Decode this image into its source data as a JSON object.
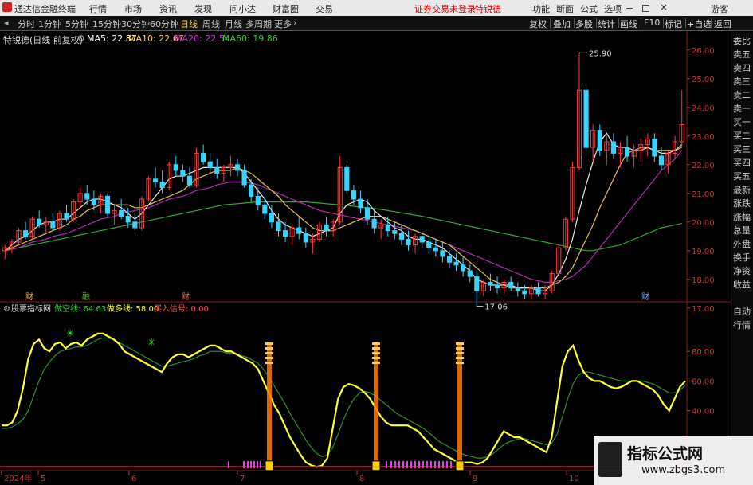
{
  "titlebar": {
    "app_name": "通达信金融终端",
    "menus": [
      "行情",
      "市场",
      "资讯",
      "发现",
      "问小达",
      "财富圈",
      "交易"
    ],
    "login_status": "证券交易未登录",
    "stock_name": "特锐德",
    "right_menus": [
      "功能",
      "断面",
      "公式",
      "选项"
    ],
    "user": "游客"
  },
  "toolbar": {
    "periods": [
      "分时",
      "1分钟",
      "5分钟",
      "15分钟",
      "30分钟",
      "60分钟",
      "日线",
      "周线",
      "月线",
      "多周期",
      "更多"
    ],
    "active_period": "日线",
    "right_buttons": [
      "复权",
      "叠加",
      "多股",
      "统计",
      "画线",
      "F10",
      "标记",
      "+自选",
      "返回"
    ]
  },
  "ma_line": {
    "title": "特锐德(日线 前复权)",
    "ma5": "MA5: 22.87",
    "ma10": "MA10: 22.67",
    "ma20": "MA20: 22.54",
    "ma60": "MA60: 19.86",
    "colors": {
      "ma5": "#ffffff",
      "ma10": "#ffd24d",
      "ma20": "#cc33cc",
      "ma60": "#33cc33"
    }
  },
  "indicator_line": {
    "title": "股票指标网",
    "line1": "做空线: 64.63",
    "line2": "做多线: 58.00",
    "line3": "买入信号: 0.00"
  },
  "right_sidebar": {
    "labels": [
      "委比",
      "卖五",
      "卖四",
      "卖三",
      "卖二",
      "卖一",
      "买一",
      "买二",
      "买三",
      "买四",
      "买五",
      "最新",
      "涨跌",
      "涨幅",
      "总量",
      "外盘",
      "换手",
      "净资",
      "收益"
    ],
    "bottom_labels": [
      "自动",
      "行情"
    ]
  },
  "markers": {
    "high": "25.90",
    "low": "17.06",
    "event_top_1": "财",
    "event_bottom_1": "融",
    "event_bottom_2": "财",
    "event_bottom_3": "财"
  },
  "chart_data": {
    "type": "line",
    "price_axis": {
      "ticks": [
        "26.00",
        "25.00",
        "24.00",
        "23.00",
        "22.00",
        "21.00",
        "20.00",
        "19.00",
        "18.00",
        "17.00"
      ],
      "ylim": [
        16.8,
        26.3
      ]
    },
    "indicator_axis": {
      "ticks": [
        "80.00",
        "60.00",
        "40.00"
      ],
      "ylim": [
        0,
        100
      ]
    },
    "x_ticks": [
      "2024年",
      "5",
      "6",
      "7",
      "8",
      "9",
      "10"
    ],
    "candles": [
      [
        19.0,
        19.2,
        18.7,
        19.1
      ],
      [
        19.1,
        19.4,
        18.9,
        19.3
      ],
      [
        19.3,
        19.8,
        19.2,
        19.7
      ],
      [
        19.7,
        20.0,
        19.4,
        19.5
      ],
      [
        19.5,
        20.2,
        19.4,
        20.1
      ],
      [
        20.1,
        20.4,
        19.8,
        19.9
      ],
      [
        19.9,
        20.2,
        19.6,
        20.0
      ],
      [
        20.0,
        20.3,
        19.7,
        19.8
      ],
      [
        19.8,
        20.4,
        19.7,
        20.3
      ],
      [
        20.3,
        20.6,
        20.0,
        20.1
      ],
      [
        20.1,
        20.8,
        20.0,
        20.7
      ],
      [
        20.7,
        21.2,
        20.5,
        21.0
      ],
      [
        21.0,
        21.3,
        20.6,
        20.8
      ],
      [
        20.8,
        21.1,
        20.4,
        20.6
      ],
      [
        20.6,
        21.0,
        20.3,
        20.9
      ],
      [
        20.9,
        21.0,
        20.2,
        20.3
      ],
      [
        20.3,
        20.6,
        19.9,
        20.4
      ],
      [
        20.4,
        20.8,
        20.1,
        20.2
      ],
      [
        20.2,
        20.5,
        19.8,
        20.0
      ],
      [
        20.0,
        20.3,
        19.7,
        19.8
      ],
      [
        19.8,
        20.9,
        19.7,
        20.8
      ],
      [
        20.8,
        21.6,
        20.7,
        21.5
      ],
      [
        21.5,
        21.9,
        21.2,
        21.4
      ],
      [
        21.4,
        21.8,
        21.0,
        21.2
      ],
      [
        21.2,
        22.1,
        21.1,
        22.0
      ],
      [
        22.0,
        22.3,
        21.6,
        21.8
      ],
      [
        21.8,
        22.0,
        21.4,
        21.6
      ],
      [
        21.6,
        21.9,
        21.2,
        21.3
      ],
      [
        21.3,
        22.6,
        21.2,
        22.4
      ],
      [
        22.4,
        22.7,
        22.0,
        22.1
      ],
      [
        22.1,
        22.4,
        21.7,
        21.9
      ],
      [
        21.9,
        22.2,
        21.5,
        21.7
      ],
      [
        21.7,
        22.0,
        21.4,
        21.9
      ],
      [
        21.9,
        22.3,
        21.6,
        22.0
      ],
      [
        22.0,
        22.2,
        21.6,
        21.8
      ],
      [
        21.8,
        22.0,
        21.2,
        21.3
      ],
      [
        21.3,
        21.5,
        20.7,
        20.9
      ],
      [
        20.9,
        21.2,
        20.4,
        20.6
      ],
      [
        20.6,
        20.9,
        20.1,
        20.3
      ],
      [
        20.3,
        20.6,
        19.8,
        20.0
      ],
      [
        20.0,
        20.3,
        19.5,
        19.7
      ],
      [
        19.7,
        20.0,
        19.3,
        19.5
      ],
      [
        19.5,
        19.9,
        19.2,
        19.8
      ],
      [
        19.8,
        20.2,
        19.4,
        19.6
      ],
      [
        19.6,
        19.8,
        19.1,
        19.3
      ],
      [
        19.3,
        19.6,
        18.9,
        19.4
      ],
      [
        19.4,
        20.0,
        19.3,
        19.9
      ],
      [
        19.9,
        20.2,
        19.5,
        19.7
      ],
      [
        19.7,
        20.1,
        19.5,
        20.0
      ],
      [
        20.0,
        22.3,
        19.9,
        21.9
      ],
      [
        21.9,
        22.0,
        21.0,
        21.1
      ],
      [
        21.1,
        21.3,
        20.6,
        20.8
      ],
      [
        20.8,
        21.1,
        20.3,
        20.5
      ],
      [
        20.5,
        20.8,
        19.9,
        20.1
      ],
      [
        20.1,
        20.4,
        19.6,
        19.8
      ],
      [
        19.8,
        20.1,
        19.4,
        19.9
      ],
      [
        19.9,
        20.2,
        19.5,
        19.7
      ],
      [
        19.7,
        20.0,
        19.4,
        19.6
      ],
      [
        19.6,
        19.9,
        19.2,
        19.4
      ],
      [
        19.4,
        19.7,
        19.0,
        19.2
      ],
      [
        19.2,
        19.6,
        18.9,
        19.5
      ],
      [
        19.5,
        19.7,
        19.1,
        19.3
      ],
      [
        19.3,
        19.5,
        18.9,
        19.1
      ],
      [
        19.1,
        19.4,
        18.8,
        19.0
      ],
      [
        19.0,
        19.3,
        18.6,
        18.8
      ],
      [
        18.8,
        19.0,
        18.4,
        18.6
      ],
      [
        18.6,
        18.9,
        18.3,
        18.5
      ],
      [
        18.5,
        18.8,
        18.1,
        18.3
      ],
      [
        18.3,
        18.5,
        17.9,
        18.1
      ],
      [
        18.1,
        18.3,
        17.06,
        17.6
      ],
      [
        17.6,
        18.0,
        17.4,
        17.9
      ],
      [
        17.9,
        18.2,
        17.6,
        17.8
      ],
      [
        17.8,
        18.1,
        17.5,
        17.7
      ],
      [
        17.7,
        18.0,
        17.5,
        17.9
      ],
      [
        17.9,
        18.1,
        17.6,
        17.7
      ],
      [
        17.7,
        17.9,
        17.4,
        17.6
      ],
      [
        17.6,
        17.8,
        17.3,
        17.5
      ],
      [
        17.5,
        17.8,
        17.3,
        17.7
      ],
      [
        17.7,
        17.9,
        17.4,
        17.5
      ],
      [
        17.5,
        17.8,
        17.3,
        17.6
      ],
      [
        17.6,
        18.3,
        17.5,
        18.2
      ],
      [
        18.2,
        19.2,
        18.1,
        19.1
      ],
      [
        19.1,
        20.2,
        19.0,
        20.1
      ],
      [
        20.1,
        22.1,
        20.0,
        21.9
      ],
      [
        21.9,
        25.9,
        21.8,
        24.6
      ],
      [
        24.6,
        24.8,
        22.3,
        22.6
      ],
      [
        22.6,
        23.4,
        22.1,
        23.2
      ],
      [
        23.2,
        23.4,
        22.3,
        22.5
      ],
      [
        22.5,
        23.0,
        22.0,
        22.8
      ],
      [
        22.8,
        23.1,
        22.2,
        22.4
      ],
      [
        22.4,
        22.8,
        21.9,
        22.6
      ],
      [
        22.6,
        23.0,
        22.1,
        22.3
      ],
      [
        22.3,
        22.7,
        21.9,
        22.5
      ],
      [
        22.5,
        22.9,
        22.1,
        22.7
      ],
      [
        22.7,
        23.1,
        22.3,
        22.9
      ],
      [
        22.9,
        23.1,
        22.1,
        22.3
      ],
      [
        22.3,
        22.6,
        21.8,
        22.0
      ],
      [
        22.0,
        22.5,
        21.7,
        22.4
      ],
      [
        22.4,
        23.0,
        22.2,
        22.8
      ],
      [
        22.8,
        24.6,
        22.6,
        23.4
      ]
    ],
    "ma5": [
      19.0,
      19.2,
      19.4,
      19.5,
      19.7,
      19.9,
      20.0,
      20.0,
      20.1,
      20.1,
      20.3,
      20.5,
      20.7,
      20.8,
      20.8,
      20.7,
      20.6,
      20.5,
      20.3,
      20.1,
      20.3,
      20.6,
      20.9,
      21.2,
      21.5,
      21.6,
      21.6,
      21.7,
      21.8,
      21.9,
      21.9,
      21.9,
      21.9,
      21.9,
      21.9,
      21.7,
      21.4,
      21.1,
      20.8,
      20.4,
      20.1,
      19.9,
      19.8,
      19.7,
      19.6,
      19.5,
      19.6,
      19.7,
      19.8,
      20.3,
      20.6,
      20.7,
      20.8,
      20.7,
      20.4,
      20.2,
      20.0,
      19.8,
      19.7,
      19.5,
      19.4,
      19.4,
      19.3,
      19.2,
      19.1,
      18.9,
      18.7,
      18.5,
      18.3,
      18.0,
      17.9,
      17.8,
      17.8,
      17.8,
      17.8,
      17.7,
      17.7,
      17.7,
      17.6,
      17.6,
      17.8,
      18.2,
      18.7,
      19.4,
      20.4,
      21.3,
      22.1,
      22.8,
      23.1,
      22.7,
      22.6,
      22.6,
      22.5,
      22.5,
      22.6,
      22.5,
      22.4,
      22.4,
      22.5,
      22.7
    ],
    "ma10": [
      19.0,
      19.1,
      19.2,
      19.3,
      19.4,
      19.5,
      19.6,
      19.7,
      19.8,
      19.9,
      20.1,
      20.2,
      20.4,
      20.5,
      20.6,
      20.6,
      20.6,
      20.6,
      20.6,
      20.5,
      20.5,
      20.6,
      20.7,
      20.8,
      20.9,
      21.0,
      21.1,
      21.3,
      21.5,
      21.6,
      21.7,
      21.8,
      21.8,
      21.8,
      21.9,
      21.8,
      21.7,
      21.5,
      21.3,
      21.1,
      20.9,
      20.6,
      20.4,
      20.2,
      20.0,
      19.8,
      19.7,
      19.7,
      19.7,
      19.8,
      19.9,
      20.0,
      20.1,
      20.2,
      20.2,
      20.2,
      20.1,
      20.0,
      19.9,
      19.8,
      19.7,
      19.6,
      19.5,
      19.4,
      19.3,
      19.2,
      19.0,
      18.8,
      18.6,
      18.4,
      18.2,
      18.0,
      17.9,
      17.8,
      17.7,
      17.7,
      17.7,
      17.7,
      17.7,
      17.7,
      17.8,
      17.9,
      18.1,
      18.4,
      18.9,
      19.4,
      19.9,
      20.5,
      21.0,
      21.5,
      22.0,
      22.4,
      22.5,
      22.6,
      22.6,
      22.5,
      22.5,
      22.5,
      22.5,
      22.6
    ],
    "ma20": [
      19.0,
      19.05,
      19.1,
      19.2,
      19.3,
      19.35,
      19.4,
      19.5,
      19.55,
      19.6,
      19.7,
      19.8,
      19.9,
      20.0,
      20.1,
      20.15,
      20.2,
      20.3,
      20.35,
      20.4,
      20.45,
      20.5,
      20.6,
      20.7,
      20.8,
      20.85,
      20.9,
      21.0,
      21.1,
      21.15,
      21.2,
      21.3,
      21.35,
      21.4,
      21.4,
      21.4,
      21.35,
      21.3,
      21.2,
      21.1,
      21.0,
      20.9,
      20.8,
      20.7,
      20.6,
      20.5,
      20.4,
      20.35,
      20.3,
      20.25,
      20.2,
      20.15,
      20.1,
      20.05,
      20.0,
      19.95,
      19.9,
      19.85,
      19.8,
      19.75,
      19.7,
      19.6,
      19.5,
      19.4,
      19.3,
      19.2,
      19.1,
      19.0,
      18.9,
      18.8,
      18.7,
      18.6,
      18.5,
      18.4,
      18.3,
      18.2,
      18.1,
      18.0,
      17.95,
      17.9,
      17.9,
      17.95,
      18.0,
      18.1,
      18.3,
      18.5,
      18.8,
      19.1,
      19.4,
      19.7,
      20.0,
      20.3,
      20.6,
      20.9,
      21.2,
      21.5,
      21.8,
      22.0,
      22.2,
      22.5
    ],
    "ma60": [
      19.0,
      19.05,
      19.1,
      19.15,
      19.2,
      19.25,
      19.3,
      19.35,
      19.4,
      19.45,
      19.5,
      19.55,
      19.6,
      19.65,
      19.7,
      19.75,
      19.8,
      19.85,
      19.9,
      19.95,
      20.0,
      20.05,
      20.1,
      20.15,
      20.2,
      20.25,
      20.3,
      20.35,
      20.4,
      20.45,
      20.5,
      20.55,
      20.6,
      20.62,
      20.64,
      20.66,
      20.68,
      20.7,
      20.7,
      20.7,
      20.7,
      20.7,
      20.7,
      20.7,
      20.7,
      20.68,
      20.66,
      20.64,
      20.62,
      20.6,
      20.58,
      20.55,
      20.52,
      20.5,
      20.47,
      20.44,
      20.4,
      20.36,
      20.32,
      20.28,
      20.24,
      20.2,
      20.15,
      20.1,
      20.05,
      20.0,
      19.95,
      19.9,
      19.85,
      19.8,
      19.75,
      19.7,
      19.65,
      19.6,
      19.55,
      19.5,
      19.45,
      19.4,
      19.35,
      19.3,
      19.25,
      19.2,
      19.15,
      19.1,
      19.05,
      19.0,
      19.0,
      19.05,
      19.1,
      19.15,
      19.2,
      19.3,
      19.4,
      19.5,
      19.6,
      19.7,
      19.8,
      19.85,
      19.9,
      19.95
    ],
    "indicator_yellow": [
      30,
      30,
      32,
      40,
      55,
      75,
      85,
      88,
      82,
      80,
      85,
      86,
      82,
      85,
      86,
      84,
      88,
      90,
      92,
      92,
      90,
      88,
      85,
      80,
      78,
      76,
      74,
      72,
      70,
      68,
      66,
      72,
      76,
      78,
      78,
      76,
      78,
      80,
      82,
      84,
      84,
      82,
      80,
      80,
      78,
      76,
      74,
      72,
      68,
      60,
      52,
      44,
      38,
      30,
      22,
      16,
      10,
      5,
      3,
      2,
      3,
      8,
      28,
      48,
      56,
      58,
      57,
      55,
      52,
      48,
      42,
      36,
      32,
      30,
      30,
      30,
      30,
      28,
      26,
      22,
      18,
      14,
      12,
      10,
      8,
      6,
      5,
      5,
      5,
      4,
      5,
      8,
      14,
      20,
      26,
      24,
      22,
      22,
      20,
      18,
      16,
      14,
      12,
      22,
      46,
      70,
      80,
      84,
      74,
      66,
      62,
      60,
      60,
      58,
      56,
      55,
      56,
      58,
      60,
      60,
      58,
      56,
      54,
      50,
      44,
      40,
      48,
      56,
      60
    ],
    "indicator_green": [
      28,
      28,
      29,
      31,
      34,
      40,
      50,
      60,
      68,
      73,
      77,
      80,
      81,
      82,
      83,
      83,
      84,
      86,
      88,
      89,
      89,
      88,
      86,
      84,
      82,
      80,
      78,
      76,
      74,
      72,
      70,
      70,
      71,
      72,
      73,
      74,
      75,
      77,
      78,
      80,
      80,
      80,
      79,
      79,
      78,
      77,
      76,
      74,
      72,
      68,
      63,
      57,
      51,
      45,
      38,
      32,
      26,
      20,
      15,
      11,
      9,
      10,
      15,
      24,
      34,
      42,
      48,
      52,
      53,
      52,
      50,
      47,
      44,
      41,
      38,
      36,
      34,
      32,
      30,
      28,
      25,
      22,
      19,
      17,
      15,
      13,
      11,
      10,
      9,
      8,
      8,
      9,
      11,
      14,
      17,
      19,
      20,
      21,
      21,
      20,
      19,
      18,
      17,
      18,
      24,
      36,
      48,
      58,
      64,
      66,
      66,
      65,
      64,
      63,
      62,
      61,
      60,
      60,
      60,
      60,
      60,
      59,
      58,
      56,
      54,
      52,
      52,
      54,
      57
    ]
  }
}
